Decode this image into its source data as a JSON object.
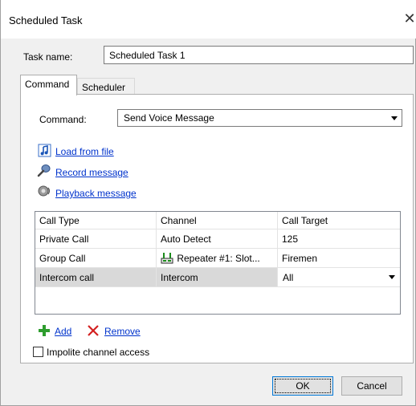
{
  "window": {
    "title": "Scheduled Task",
    "close_glyph": "✕"
  },
  "task_name": {
    "label": "Task name:",
    "value": "Scheduled Task 1"
  },
  "tabs": [
    {
      "label": "Command",
      "active": true
    },
    {
      "label": "Scheduler",
      "active": false
    }
  ],
  "command": {
    "label": "Command:",
    "value": "Send Voice Message"
  },
  "links": {
    "load": "Load from file",
    "record": "Record message",
    "playback": "Playback message"
  },
  "grid": {
    "columns": [
      "Call Type",
      "Channel",
      "Call Target"
    ],
    "rows": [
      {
        "call_type": "Private Call",
        "channel": "Auto Detect",
        "call_target": "125"
      },
      {
        "call_type": "Group Call",
        "channel": "Repeater #1: Slot...",
        "channel_icon": "repeater-icon",
        "call_target": "Firemen"
      },
      {
        "call_type": "Intercom call",
        "channel": "Intercom",
        "call_target": "All",
        "selected": true,
        "editing": true
      }
    ]
  },
  "actions": {
    "add": "Add",
    "remove": "Remove"
  },
  "impolite": {
    "label": "Impolite channel access",
    "checked": false
  },
  "buttons": {
    "ok": "OK",
    "cancel": "Cancel"
  },
  "colors": {
    "link": "#0033cc",
    "accent": "#0078d7",
    "add_green": "#2e9d2e",
    "remove_red": "#d32020"
  }
}
